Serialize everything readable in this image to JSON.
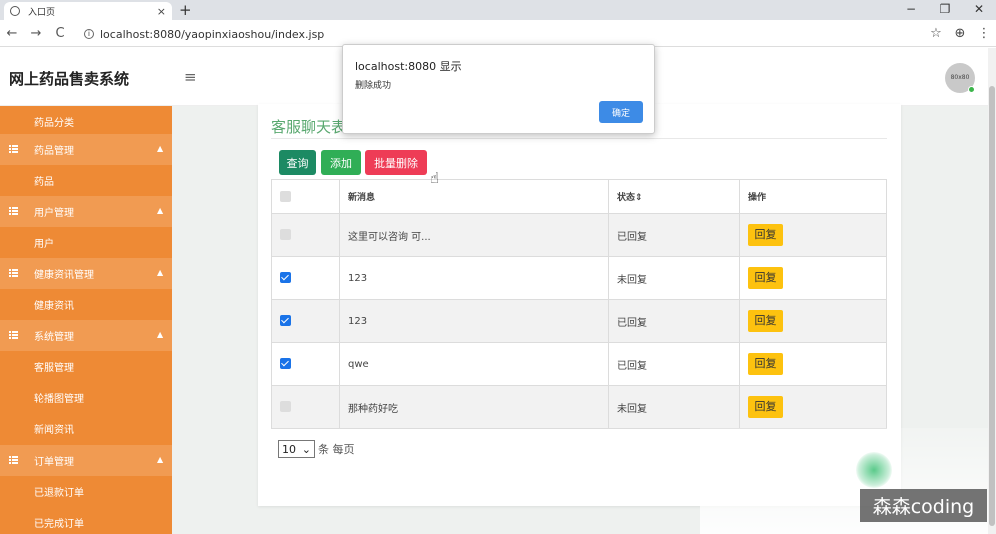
{
  "browser": {
    "tab_title": "入口页",
    "tab_close": "×",
    "new_tab": "+",
    "window_controls": [
      "−",
      "❐",
      "✕"
    ],
    "nav": [
      "←",
      "→",
      "C"
    ],
    "url": "localhost:8080/yaopinxiaoshou/index.jsp",
    "right_icons": [
      "☆",
      "⊕",
      "⋮"
    ]
  },
  "header": {
    "title": "网上药品售卖系统",
    "menu_toggle": "≡",
    "avatar_text": "80x80"
  },
  "sidebar": {
    "items": [
      {
        "label": "药品分类",
        "type": "sub"
      },
      {
        "label": "药品管理",
        "type": "group"
      },
      {
        "label": "药品",
        "type": "sub"
      },
      {
        "label": "用户管理",
        "type": "group"
      },
      {
        "label": "用户",
        "type": "sub"
      },
      {
        "label": "健康资讯管理",
        "type": "group"
      },
      {
        "label": "健康资讯",
        "type": "sub"
      },
      {
        "label": "系统管理",
        "type": "group"
      },
      {
        "label": "客服管理",
        "type": "sub"
      },
      {
        "label": "轮播图管理",
        "type": "sub"
      },
      {
        "label": "新闻资讯",
        "type": "sub"
      },
      {
        "label": "订单管理",
        "type": "group"
      },
      {
        "label": "已退款订单",
        "type": "sub"
      },
      {
        "label": "已完成订单",
        "type": "sub"
      }
    ]
  },
  "panel": {
    "title": "客服聊天表",
    "buttons": {
      "query": "查询",
      "add": "添加",
      "batch_delete": "批量删除"
    },
    "columns": [
      "",
      "新消息",
      "状态⇕",
      "操作"
    ],
    "rows": [
      {
        "checked": false,
        "message": "这里可以咨询 可...",
        "status": "已回复",
        "action": "回复"
      },
      {
        "checked": true,
        "message": "123",
        "status": "未回复",
        "action": "回复"
      },
      {
        "checked": true,
        "message": "123",
        "status": "已回复",
        "action": "回复"
      },
      {
        "checked": true,
        "message": "qwe",
        "status": "已回复",
        "action": "回复"
      },
      {
        "checked": false,
        "message": "那种药好吃",
        "status": "未回复",
        "action": "回复"
      }
    ],
    "page_size": "10",
    "page_size_suffix": "条 每页"
  },
  "dialog": {
    "title": "localhost:8080 显示",
    "message": "删除成功",
    "ok_label": "确定"
  },
  "watermark": "森森coding"
}
